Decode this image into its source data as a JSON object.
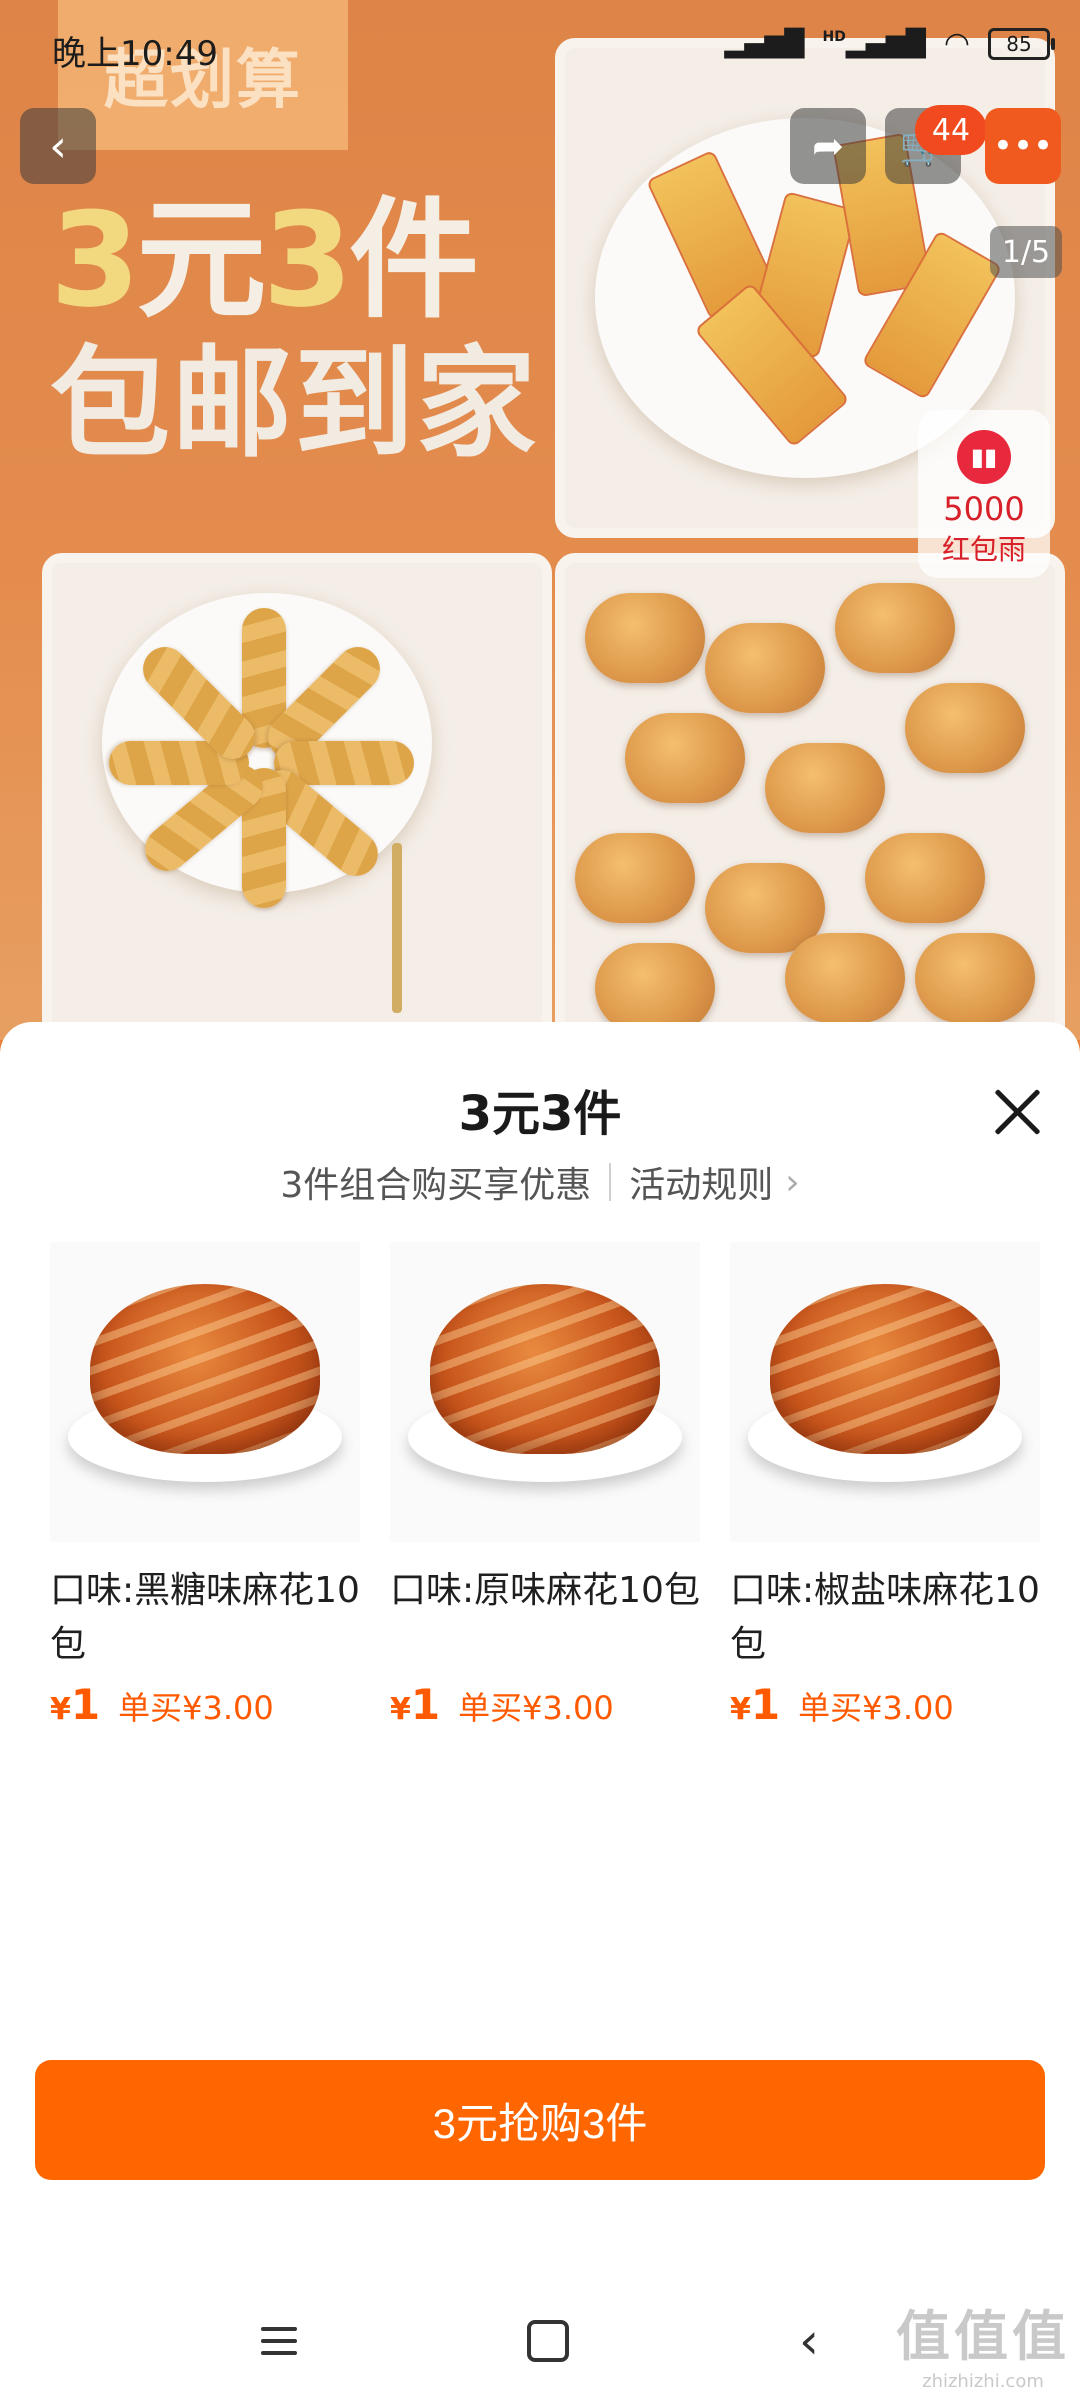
{
  "status_bar": {
    "time": "晚上10:49",
    "signal_label": "HD",
    "battery": "85"
  },
  "top_nav": {
    "cart_badge": "44",
    "image_counter": "1/5"
  },
  "hero": {
    "brand_badge": "超划算",
    "promo_line1_a": "3",
    "promo_line1_b": "元",
    "promo_line1_c": "3",
    "promo_line1_d": "件",
    "promo_line2": "包邮到家"
  },
  "red_packet": {
    "amount": "5000",
    "label": "红包雨"
  },
  "sheet": {
    "title": "3元3件",
    "subtitle": "3件组合购买享优惠",
    "rules_link": "活动规则",
    "products": [
      {
        "name": "口味:黑糖味麻花10包",
        "currency": "¥",
        "price": "1",
        "single_price": "单买¥3.00"
      },
      {
        "name": "口味:原味麻花10包",
        "currency": "¥",
        "price": "1",
        "single_price": "单买¥3.00"
      },
      {
        "name": "口味:椒盐味麻花10包",
        "currency": "¥",
        "price": "1",
        "single_price": "单买¥3.00"
      }
    ],
    "buy_button": "3元抢购3件"
  },
  "watermark": {
    "big": "值值值",
    "small": "zhizhizhi.com"
  },
  "colors": {
    "accent": "#ff6600",
    "price": "#ff5a00",
    "hero_bg": "#e07a32"
  }
}
